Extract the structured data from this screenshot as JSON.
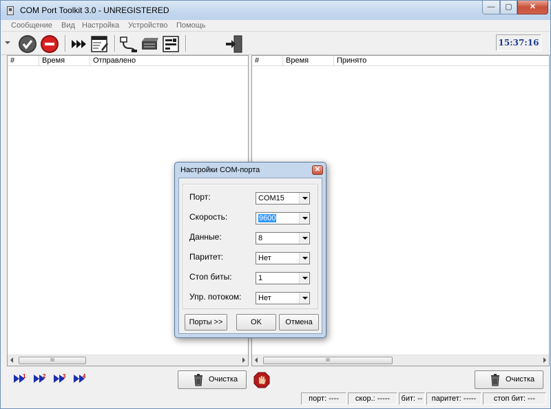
{
  "window": {
    "title": "COM Port Toolkit 3.0 - UNREGISTERED"
  },
  "menu": [
    "Сообщение",
    "Вид",
    "Настройка",
    "Устройство",
    "Помощь"
  ],
  "toolbar": {
    "icons": [
      "dropdown-arrow-icon",
      "check-icon",
      "stop-icon",
      "fast-forward-icon",
      "edit-table-icon",
      "connector-icon",
      "device-icon",
      "settings-panel-icon",
      "exit-icon"
    ],
    "clock": "15:37:16"
  },
  "sent_pane": {
    "columns": [
      "#",
      "Время",
      "Отправлено"
    ],
    "scroll_thumb": "III"
  },
  "received_pane": {
    "columns": [
      "#",
      "Время",
      "Принято"
    ],
    "scroll_thumb": "III"
  },
  "bottom": {
    "clear_label": "Очистка",
    "clear_label_right": "Очистка",
    "mini_buttons": [
      "1",
      "2",
      "3",
      "4"
    ]
  },
  "status": {
    "port": "порт: ----",
    "speed": "скор.: -----",
    "bits": "бит: --",
    "parity": "паритет: -----",
    "stopbits": "стоп бит: ---"
  },
  "dialog": {
    "title": "Настройки COM-порта",
    "fields": [
      {
        "label": "Порт:",
        "value": "COM15"
      },
      {
        "label": "Скорость:",
        "value": "9600"
      },
      {
        "label": "Данные:",
        "value": "8"
      },
      {
        "label": "Паритет:",
        "value": "Нет"
      },
      {
        "label": "Стоп биты:",
        "value": "1"
      },
      {
        "label": "Упр. потоком:",
        "value": "Нет"
      }
    ],
    "ports_button": "Порты >>",
    "ok_button": "OK",
    "cancel_button": "Отмена"
  },
  "colors": {
    "clock_text": "#1c3a92",
    "selection": "#3399ff",
    "close_button": "#c8513a"
  }
}
